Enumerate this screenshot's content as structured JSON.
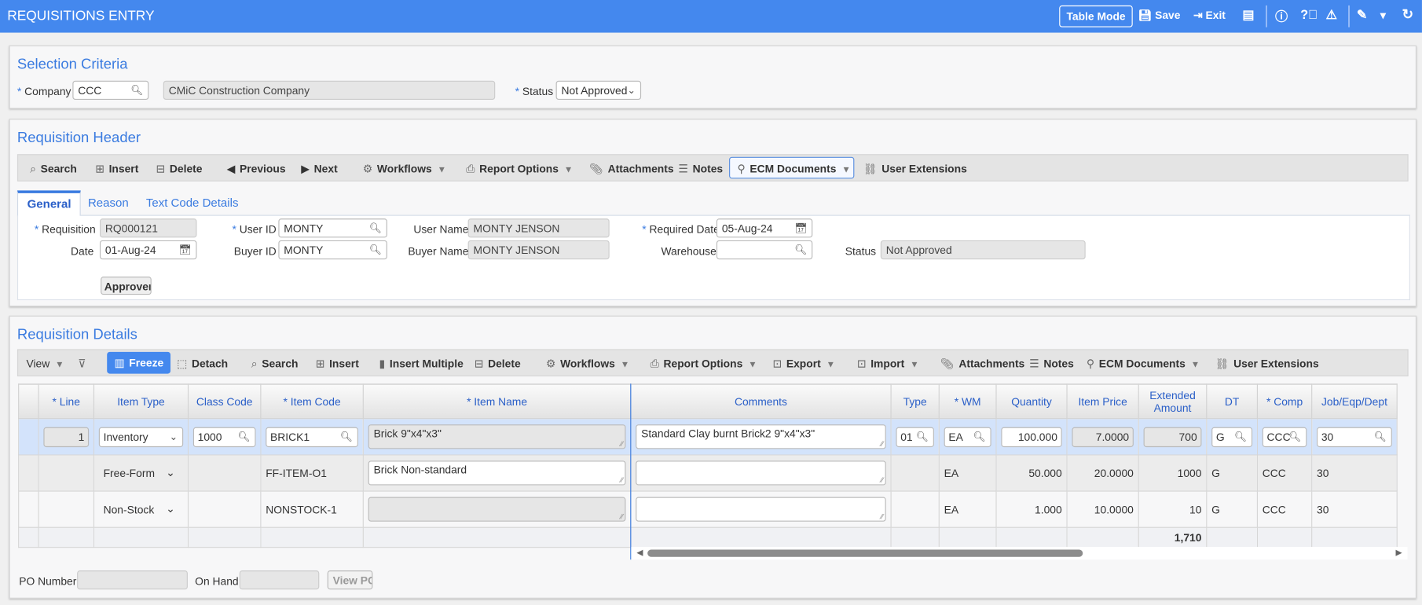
{
  "app": {
    "title": "REQUISITIONS ENTRY",
    "table_mode": "Table Mode",
    "save": "Save",
    "exit": "Exit"
  },
  "selection": {
    "title": "Selection Criteria",
    "company_label": "Company",
    "company": "CCC",
    "company_name": "CMiC Construction Company",
    "status_label": "Status",
    "status": "Not Approved"
  },
  "header": {
    "title": "Requisition Header",
    "toolbar": [
      "Search",
      "Insert",
      "Delete",
      "Previous",
      "Next",
      "Workflows",
      "Report Options",
      "Attachments",
      "Notes",
      "ECM Documents",
      "User Extensions"
    ],
    "tabs": [
      "General",
      "Reason",
      "Text Code Details"
    ],
    "fields": {
      "requisition_label": "Requisition",
      "requisition": "RQ000121",
      "date_label": "Date",
      "date": "01-Aug-24",
      "user_id_label": "User ID",
      "user_id": "MONTY",
      "buyer_id_label": "Buyer ID",
      "buyer_id": "MONTY",
      "user_name_label": "User Name",
      "user_name": "MONTY JENSON",
      "buyer_name_label": "Buyer Name",
      "buyer_name": "MONTY JENSON",
      "required_date_label": "Required Date",
      "required_date": "05-Aug-24",
      "warehouse_label": "Warehouse",
      "warehouse": "",
      "status_label": "Status",
      "status": "Not Approved"
    },
    "approver": "Approver"
  },
  "details": {
    "title": "Requisition Details",
    "view": "View",
    "toolbar": [
      "Freeze",
      "Detach",
      "Search",
      "Insert",
      "Insert Multiple",
      "Delete",
      "Workflows",
      "Report Options",
      "Export",
      "Import",
      "Attachments",
      "Notes",
      "ECM Documents",
      "User Extensions"
    ],
    "columns": [
      "* Line",
      "Item Type",
      "Class Code",
      "* Item Code",
      "* Item Name",
      "Comments",
      "Type",
      "* WM",
      "Quantity",
      "Item Price",
      "Extended Amount",
      "DT",
      "* Comp",
      "Job/Eqp/Dept"
    ],
    "rows": [
      {
        "line": "1",
        "item_type": "Inventory",
        "class_code": "1000",
        "item_code": "BRICK1",
        "item_name": "Brick 9\"x4\"x3\"",
        "comments": "Standard Clay burnt Brick2 9\"x4\"x3\"",
        "type": "01",
        "wm": "EA",
        "quantity": "100.000",
        "price": "7.0000",
        "extended": "700",
        "dt": "G",
        "comp": "CCC",
        "job": "30"
      },
      {
        "line": "",
        "item_type": "Free-Form",
        "class_code": "",
        "item_code": "FF-ITEM-O1",
        "item_name": "Brick Non-standard",
        "comments": "",
        "type": "",
        "wm": "EA",
        "quantity": "50.000",
        "price": "20.0000",
        "extended": "1000",
        "dt": "G",
        "comp": "CCC",
        "job": "30"
      },
      {
        "line": "",
        "item_type": "Non-Stock",
        "class_code": "",
        "item_code": "NONSTOCK-1",
        "item_name": "",
        "comments": "",
        "type": "",
        "wm": "EA",
        "quantity": "1.000",
        "price": "10.0000",
        "extended": "10",
        "dt": "G",
        "comp": "CCC",
        "job": "30"
      }
    ],
    "total": "1,710",
    "po_number_label": "PO Number",
    "on_hand_label": "On Hand",
    "view_po": "View PO"
  },
  "colors": {
    "brand": "#4488ee",
    "accent": "#3a7be0",
    "selected_row": "#d3e3fb"
  }
}
